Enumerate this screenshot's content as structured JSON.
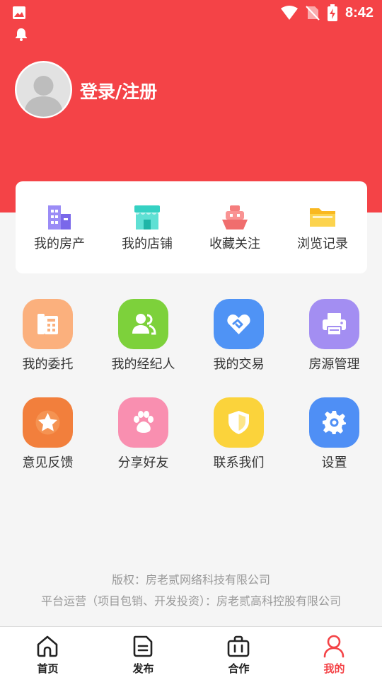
{
  "status_bar": {
    "time": "8:42",
    "icons": [
      "image-icon",
      "bell-icon",
      "wifi-icon",
      "no-sim-icon",
      "battery-charging-icon"
    ]
  },
  "profile": {
    "login_label": "登录/注册"
  },
  "quick_card": {
    "items": [
      {
        "label": "我的房产",
        "icon": "building-icon",
        "color": "#8e7ef5"
      },
      {
        "label": "我的店铺",
        "icon": "store-icon",
        "color": "#35d1c3"
      },
      {
        "label": "收藏关注",
        "icon": "ship-icon",
        "color": "#f78a8a"
      },
      {
        "label": "浏览记录",
        "icon": "folder-icon",
        "color": "#fbc531"
      }
    ]
  },
  "grid": {
    "items": [
      {
        "label": "我的委托",
        "icon": "fax-icon",
        "color": "#fbb07d"
      },
      {
        "label": "我的经纪人",
        "icon": "users-icon",
        "color": "#7dd13b"
      },
      {
        "label": "我的交易",
        "icon": "heart-handshake-icon",
        "color": "#4f93f5"
      },
      {
        "label": "房源管理",
        "icon": "printer-icon",
        "color": "#a38ef2"
      },
      {
        "label": "意见反馈",
        "icon": "star-icon",
        "color": "#f27f3c"
      },
      {
        "label": "分享好友",
        "icon": "paw-icon",
        "color": "#f98fb0"
      },
      {
        "label": "联系我们",
        "icon": "shield-icon",
        "color": "#fbd33b"
      },
      {
        "label": "设置",
        "icon": "gear-icon",
        "color": "#4f8ff5"
      }
    ]
  },
  "footer": {
    "copyright": "版权：房老贰网络科技有限公司",
    "operator": "平台运营（项目包销、开发投资）：房老贰高科控股有限公司"
  },
  "tabbar": {
    "active_color": "#f44347",
    "items": [
      {
        "label": "首页",
        "icon": "home-icon",
        "active": false
      },
      {
        "label": "发布",
        "icon": "document-icon",
        "active": false
      },
      {
        "label": "合作",
        "icon": "briefcase-icon",
        "active": false
      },
      {
        "label": "我的",
        "icon": "user-icon",
        "active": true
      }
    ]
  }
}
